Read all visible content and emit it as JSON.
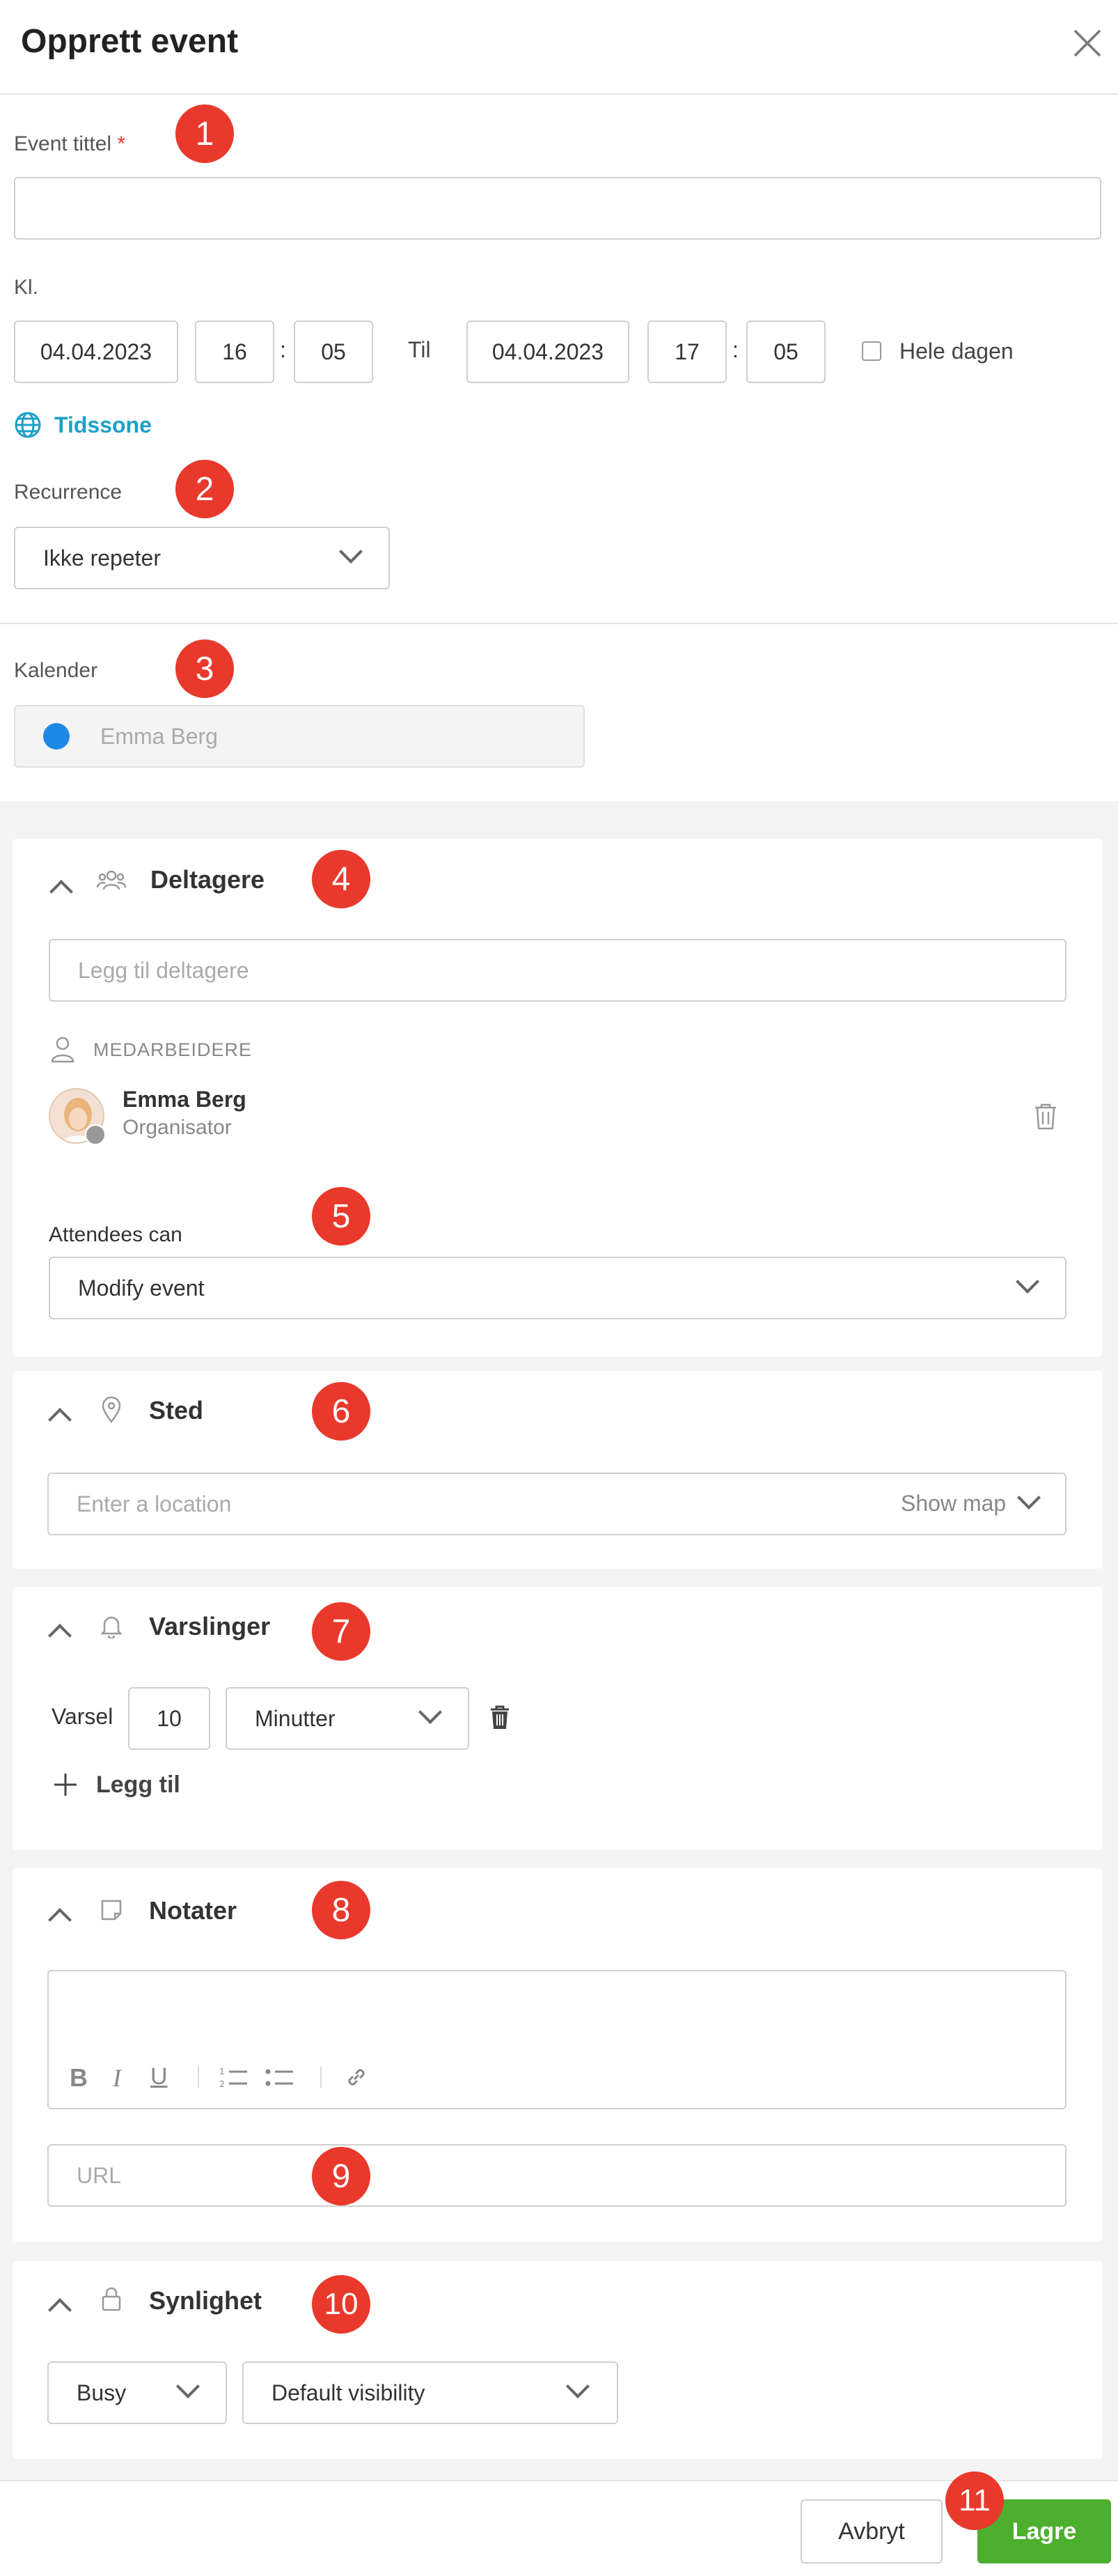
{
  "header": {
    "title": "Opprett event"
  },
  "event_title": {
    "label": "Event tittel",
    "required_mark": "*",
    "value": ""
  },
  "time": {
    "label": "Kl.",
    "start_date": "04.04.2023",
    "start_hour": "16",
    "start_minute": "05",
    "separator": ":",
    "to_label": "Til",
    "end_date": "04.04.2023",
    "end_hour": "17",
    "end_minute": "05",
    "all_day_label": "Hele dagen",
    "all_day_checked": false,
    "timezone_link": "Tidssone"
  },
  "recurrence": {
    "label": "Recurrence",
    "value": "Ikke repeter"
  },
  "calendar": {
    "label": "Kalender",
    "value": "Emma Berg",
    "color": "#1e88e5"
  },
  "participants": {
    "title": "Deltagere",
    "add_placeholder": "Legg til deltagere",
    "group_label": "MEDARBEIDERE",
    "people": [
      {
        "name": "Emma Berg",
        "role": "Organisator"
      }
    ],
    "attendees_can_label": "Attendees can",
    "attendees_can_value": "Modify event"
  },
  "location": {
    "title": "Sted",
    "placeholder": "Enter a location",
    "show_map": "Show map"
  },
  "notifications": {
    "title": "Varslinger",
    "label": "Varsel",
    "amount": "10",
    "unit": "Minutter",
    "add_label": "Legg til"
  },
  "notes": {
    "title": "Notater",
    "url_placeholder": "URL"
  },
  "visibility": {
    "title": "Synlighet",
    "status": "Busy",
    "visibility": "Default visibility"
  },
  "footer": {
    "cancel_label": "Avbryt",
    "save_label": "Lagre"
  },
  "callouts": [
    "1",
    "2",
    "3",
    "4",
    "5",
    "6",
    "7",
    "8",
    "9",
    "10",
    "11"
  ],
  "colors": {
    "accent_link": "#1ea0c8",
    "badge": "#e8392c",
    "save_green": "#4caf2d",
    "required": "#e8392c"
  }
}
